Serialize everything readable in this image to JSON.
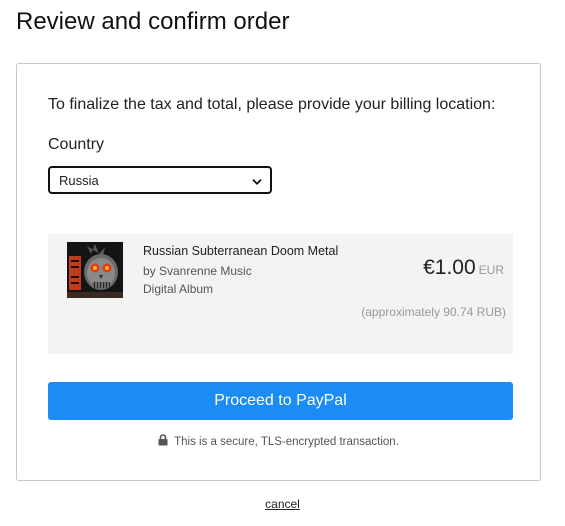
{
  "page": {
    "title": "Review and confirm order"
  },
  "billing": {
    "prompt": "To finalize the tax and total, please provide your billing location:",
    "country_label": "Country",
    "country_selected": "Russia"
  },
  "item": {
    "title": "Russian Subterranean Doom Metal",
    "artist": "by Svanrenne Music",
    "format": "Digital Album",
    "price": "€1.00",
    "currency": "EUR",
    "approx": "(approximately 90.74 RUB)",
    "art_icon": "album-cover-skull"
  },
  "actions": {
    "proceed_label": "Proceed to PayPal",
    "secure_text": "This is a secure, TLS-encrypted transaction.",
    "cancel_label": "cancel"
  },
  "colors": {
    "primary_button": "#1b8cf6",
    "panel_bg": "#f3f3f3",
    "muted_text": "#999999"
  }
}
